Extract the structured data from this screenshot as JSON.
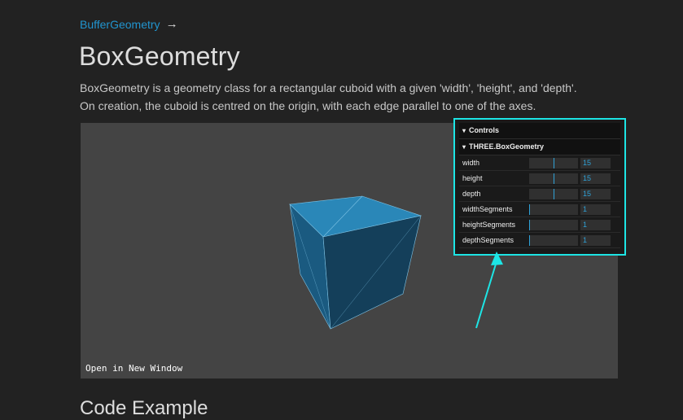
{
  "breadcrumb": {
    "link": "BufferGeometry",
    "arrow": "→"
  },
  "page": {
    "title": "BoxGeometry",
    "description_line1": "BoxGeometry is a geometry class for a rectangular cuboid with a given 'width', 'height', and 'depth'.",
    "description_line2": "On creation, the cuboid is centred on the origin, with each edge parallel to one of the axes.",
    "next_heading": "Code Example"
  },
  "viewport": {
    "open_link": "Open in New Window"
  },
  "gui": {
    "root_title": "Controls",
    "folder_title": "THREE.BoxGeometry",
    "params": [
      {
        "label": "width",
        "value": "15",
        "fill_fraction": 0.5
      },
      {
        "label": "height",
        "value": "15",
        "fill_fraction": 0.5
      },
      {
        "label": "depth",
        "value": "15",
        "fill_fraction": 0.5
      },
      {
        "label": "widthSegments",
        "value": "1",
        "fill_fraction": 0.0
      },
      {
        "label": "heightSegments",
        "value": "1",
        "fill_fraction": 0.0
      },
      {
        "label": "depthSegments",
        "value": "1",
        "fill_fraction": 0.0
      }
    ]
  },
  "colors": {
    "accent": "#2194ce",
    "highlight": "#1de5e5",
    "cube_top": "#2a87b8",
    "cube_left": "#1a5a80",
    "cube_right": "#143f5a"
  }
}
